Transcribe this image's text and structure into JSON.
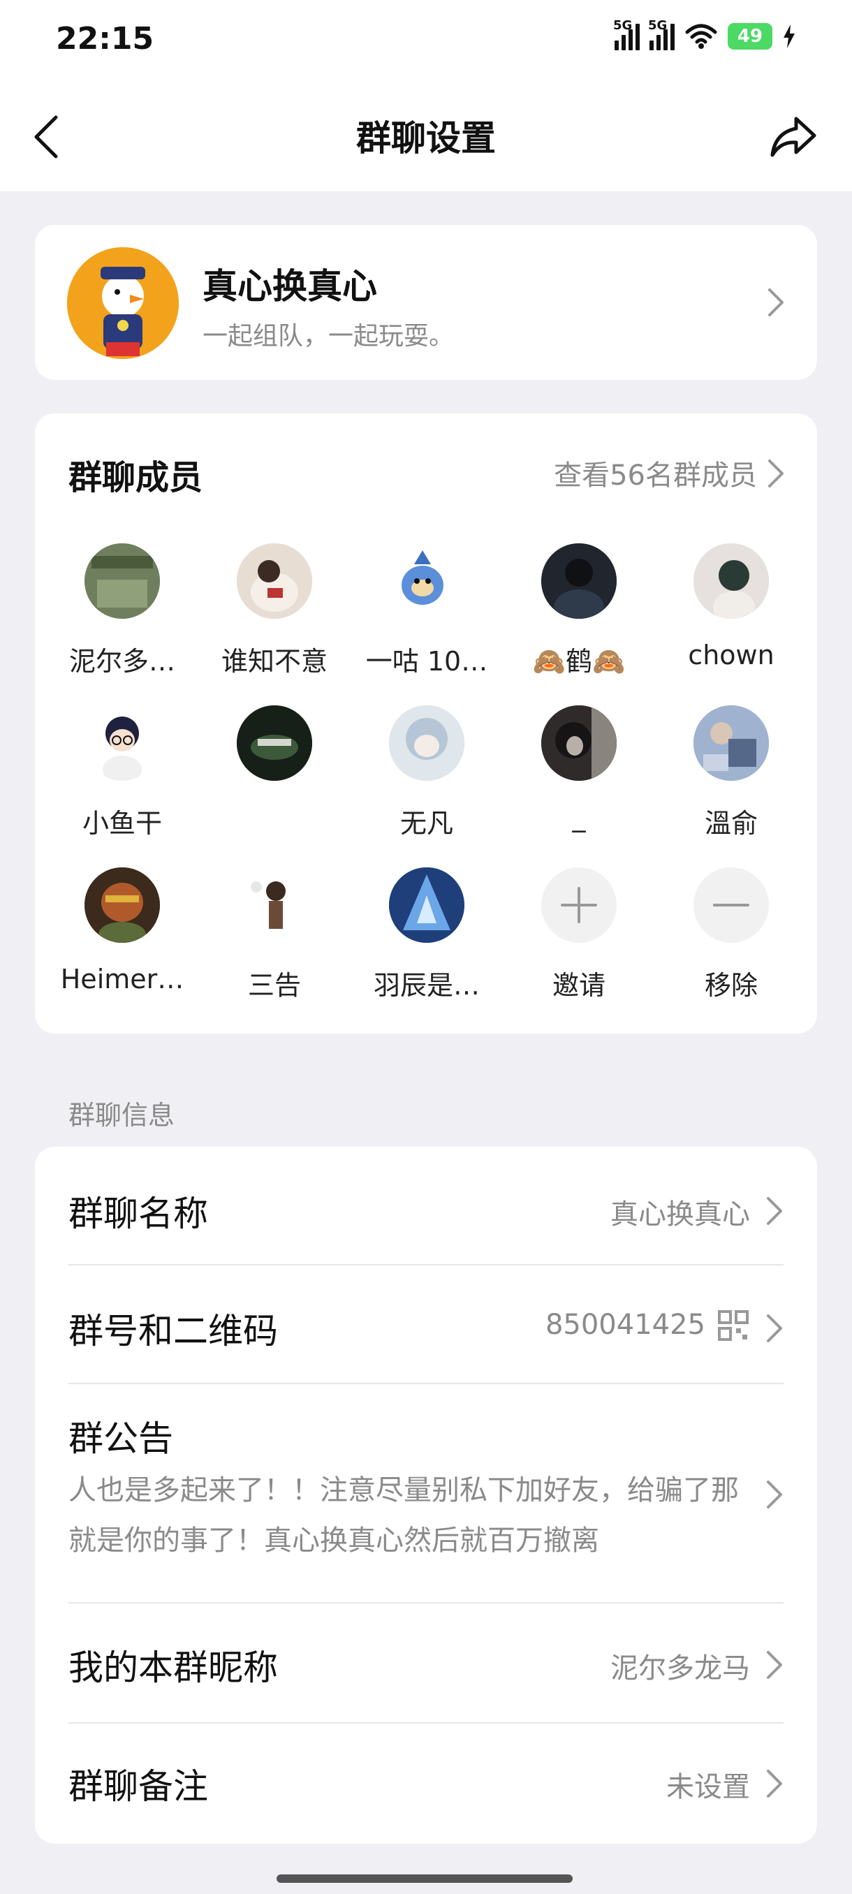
{
  "status_bar": {
    "time": "22:15",
    "network_1": "5G",
    "network_2": "5G",
    "battery": "49"
  },
  "header": {
    "title": "群聊设置",
    "back_icon": "chevron-left-icon",
    "share_icon": "share-icon"
  },
  "group": {
    "name": "真心换真心",
    "description": "一起组队，一起玩耍。"
  },
  "members": {
    "title": "群聊成员",
    "view_all": "查看56名群成员",
    "list": [
      {
        "name": "泥尔多…",
        "color": "#7b8a6a"
      },
      {
        "name": "谁知不意",
        "color": "#d9cbbf"
      },
      {
        "name": "一咕 10…",
        "color": "#5b8fd9"
      },
      {
        "name": "🙈鹤🙈",
        "color": "#2d3340"
      },
      {
        "name": "chown",
        "color": "#cfc8c4"
      },
      {
        "name": "小鱼干",
        "color": "#e9ecf1"
      },
      {
        "name": "",
        "color": "#1e2a1f"
      },
      {
        "name": "无凡",
        "color": "#b9c7d4"
      },
      {
        "name": "_",
        "color": "#3a3535"
      },
      {
        "name": "溫俞",
        "color": "#8aa0c4"
      },
      {
        "name": "Heimer…",
        "color": "#7a3b25"
      },
      {
        "name": "三告",
        "color": "#f3f3f3"
      },
      {
        "name": "羽辰是…",
        "color": "#2f5fa8"
      }
    ],
    "invite_label": "邀请",
    "remove_label": "移除"
  },
  "info": {
    "section_label": "群聊信息",
    "group_name_label": "群聊名称",
    "group_name_value": "真心换真心",
    "group_id_label": "群号和二维码",
    "group_id_value": "850041425",
    "notice_label": "群公告",
    "notice_text": "人也是多起来了！！注意尽量别私下加好友，给骗了那就是你的事了！真心换真心然后就百万撤离",
    "nickname_label": "我的本群昵称",
    "nickname_value": "泥尔多龙马",
    "remark_label": "群聊备注",
    "remark_value": "未设置"
  }
}
